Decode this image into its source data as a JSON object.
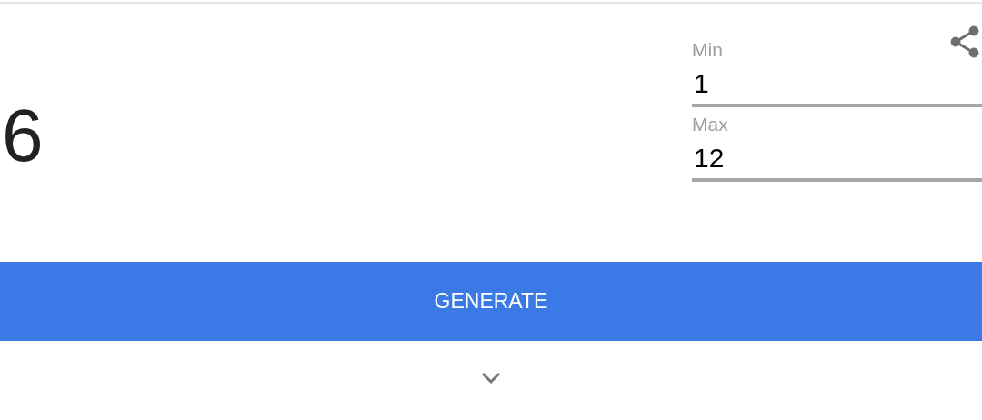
{
  "result": "6",
  "fields": [
    {
      "label": "Min",
      "value": "1"
    },
    {
      "label": "Max",
      "value": "12"
    }
  ],
  "generate_button": "GENERATE"
}
